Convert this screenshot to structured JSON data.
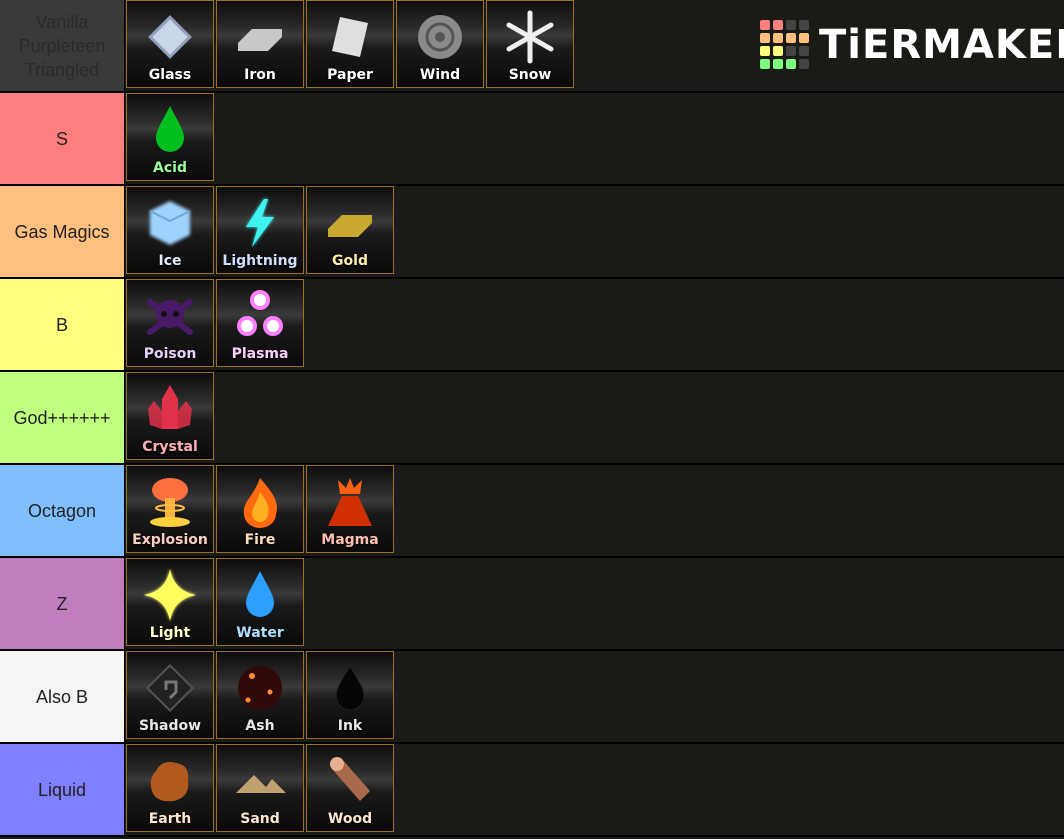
{
  "logo": {
    "text": "TiERMAKER",
    "grid_colors": [
      "#ff7f7f",
      "#ff7f7f",
      "#444",
      "#444",
      "#ffbf7f",
      "#ffbf7f",
      "#ffbf7f",
      "#ffbf7f",
      "#ffff7f",
      "#ffff7f",
      "#444",
      "#444",
      "#7fff7f",
      "#7fff7f",
      "#7fff7f",
      "#444"
    ]
  },
  "tiers": [
    {
      "label": "Vanilla Purpleteen Triangled",
      "color": "#3a3a3a",
      "text_color": "#2a2a2a",
      "items": [
        {
          "name": "Glass",
          "icon": "glass-diamond-icon",
          "color": "#c9d6e8",
          "text_color": "#ffffff"
        },
        {
          "name": "Iron",
          "icon": "iron-ingot-icon",
          "color": "#c8c8c8",
          "text_color": "#ffffff"
        },
        {
          "name": "Paper",
          "icon": "paper-sheet-icon",
          "color": "#e0e0e0",
          "text_color": "#ffffff"
        },
        {
          "name": "Wind",
          "icon": "spiral-icon",
          "color": "#8a8a8a",
          "text_color": "#ffffff"
        },
        {
          "name": "Snow",
          "icon": "snowflake-icon",
          "color": "#f0f0f0",
          "text_color": "#ffffff"
        }
      ]
    },
    {
      "label": "S",
      "color": "#ff7f7f",
      "text_color": "#222",
      "items": [
        {
          "name": "Acid",
          "icon": "droplet-icon",
          "color": "#00c020",
          "text_color": "#9cff9c"
        }
      ]
    },
    {
      "label": "Gas Magics",
      "color": "#ffbf7f",
      "text_color": "#222",
      "items": [
        {
          "name": "Ice",
          "icon": "ice-cube-icon",
          "color": "#9fd3ff",
          "text_color": "#e0f0ff"
        },
        {
          "name": "Lightning",
          "icon": "lightning-icon",
          "color": "#3ff3f3",
          "text_color": "#cfe0ff"
        },
        {
          "name": "Gold",
          "icon": "gold-ingot-icon",
          "color": "#c8a830",
          "text_color": "#ffeeaa"
        }
      ]
    },
    {
      "label": "B",
      "color": "#ffff7f",
      "text_color": "#222",
      "items": [
        {
          "name": "Poison",
          "icon": "skull-crossbones-icon",
          "color": "#4a1a6a",
          "text_color": "#e8d0ff"
        },
        {
          "name": "Plasma",
          "icon": "plasma-orbs-icon",
          "color": "#ff80ff",
          "text_color": "#ffd0ff"
        }
      ]
    },
    {
      "label": "God++++++",
      "color": "#bfff7f",
      "text_color": "#222",
      "items": [
        {
          "name": "Crystal",
          "icon": "crystal-icon",
          "color": "#e0304a",
          "text_color": "#ffb0b8"
        }
      ]
    },
    {
      "label": "Octagon",
      "color": "#7fbfff",
      "text_color": "#222",
      "items": [
        {
          "name": "Explosion",
          "icon": "mushroom-cloud-icon",
          "color": "#ff7040",
          "text_color": "#ffd0c0"
        },
        {
          "name": "Fire",
          "icon": "flame-icon",
          "color": "#ff6a10",
          "text_color": "#ffe0c0"
        },
        {
          "name": "Magma",
          "icon": "volcano-icon",
          "color": "#d03000",
          "text_color": "#ffc0b0"
        }
      ]
    },
    {
      "label": "Z",
      "color": "#bf7fbf",
      "text_color": "#222",
      "items": [
        {
          "name": "Light",
          "icon": "sparkle-icon",
          "color": "#ffff60",
          "text_color": "#ffffcc"
        },
        {
          "name": "Water",
          "icon": "droplet-icon",
          "color": "#2a9fff",
          "text_color": "#b0e0ff"
        }
      ]
    },
    {
      "label": "Also B",
      "color": "#f5f5f5",
      "text_color": "#222",
      "items": [
        {
          "name": "Shadow",
          "icon": "shadow-swirl-icon",
          "color": "#222",
          "text_color": "#e8e8e8"
        },
        {
          "name": "Ash",
          "icon": "ash-embers-icon",
          "color": "#300a0a",
          "text_color": "#e8e8e8"
        },
        {
          "name": "Ink",
          "icon": "ink-drop-icon",
          "color": "#050505",
          "text_color": "#e8e8e8"
        }
      ]
    },
    {
      "label": "Liquid",
      "color": "#7f7fff",
      "text_color": "#222",
      "items": [
        {
          "name": "Earth",
          "icon": "rock-icon",
          "color": "#b05a20",
          "text_color": "#ffe8d0"
        },
        {
          "name": "Sand",
          "icon": "dunes-icon",
          "color": "#c0a070",
          "text_color": "#ffe8d0"
        },
        {
          "name": "Wood",
          "icon": "log-icon",
          "color": "#a86a4a",
          "text_color": "#ffe8d0"
        }
      ]
    }
  ]
}
